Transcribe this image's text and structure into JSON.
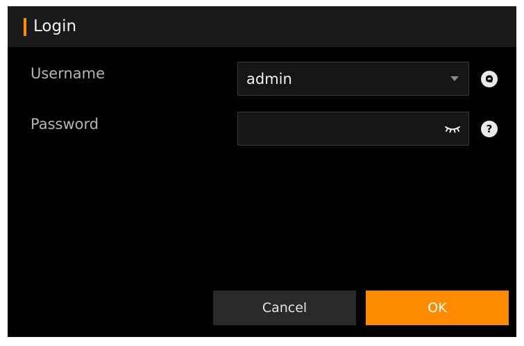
{
  "dialog": {
    "title": "Login"
  },
  "form": {
    "username_label": "Username",
    "username_value": "admin",
    "password_label": "Password",
    "password_value": "",
    "help_icon_glyph": "?"
  },
  "icons": {
    "dropdown": "chevron-down-icon",
    "password_visibility": "eye-closed-icon",
    "username_side": "user-account-icon",
    "password_side": "help-icon"
  },
  "buttons": {
    "cancel_label": "Cancel",
    "ok_label": "OK"
  },
  "colors": {
    "accent": "#ff8c00",
    "dialog_background": "#000000",
    "titlebar_background": "#1a1a1a",
    "input_background": "#161616",
    "cancel_background": "#2a2a2a"
  }
}
